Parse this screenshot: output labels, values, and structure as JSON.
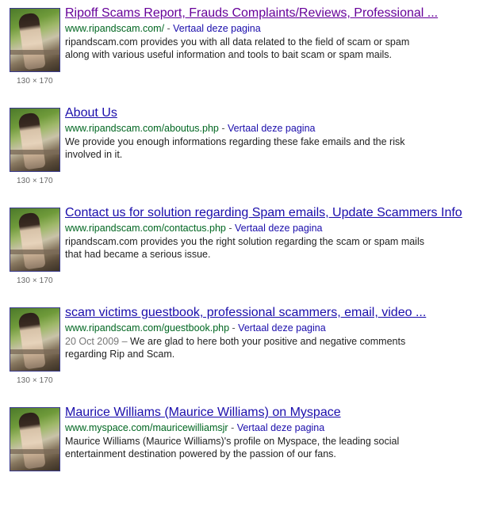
{
  "results": [
    {
      "title": "Ripoff Scams Report, Frauds Complaints/Reviews, Professional ...",
      "url": "www.ripandscam.com/",
      "translate": "Vertaal deze pagina",
      "date": "",
      "snippet_lines": [
        "ripandscam.com provides you with all data related to the field of scam or spam",
        "along with various useful information and tools to bait scam or spam mails."
      ],
      "image_size": "130 × 170"
    },
    {
      "title": "About Us",
      "url": "www.ripandscam.com/aboutus.php",
      "translate": "Vertaal deze pagina",
      "date": "",
      "snippet_lines": [
        "We provide you enough informations regarding these fake emails and the risk",
        "involved in it."
      ],
      "image_size": "130 × 170"
    },
    {
      "title": "Contact us for solution regarding Spam emails, Update Scammers Info",
      "url": "www.ripandscam.com/contactus.php",
      "translate": "Vertaal deze pagina",
      "date": "",
      "snippet_lines": [
        "ripandscam.com provides you the right solution regarding the scam or spam mails",
        "that had became a serious issue."
      ],
      "image_size": "130 × 170"
    },
    {
      "title": "scam victims guestbook, professional scammers, email, video ...",
      "url": "www.ripandscam.com/guestbook.php",
      "translate": "Vertaal deze pagina",
      "date": "20 Oct 2009 – ",
      "snippet_lines": [
        "We are glad to here both your positive and negative comments",
        "regarding Rip and Scam."
      ],
      "image_size": "130 × 170"
    },
    {
      "title": "Maurice Williams (Maurice Williams) on Myspace",
      "url": "www.myspace.com/mauricewilliamsjr",
      "translate": "Vertaal deze pagina",
      "date": "",
      "snippet_lines": [
        "Maurice Williams (Maurice Williams)'s profile on Myspace, the leading social",
        "entertainment destination powered by the passion of our fans."
      ],
      "image_size": ""
    }
  ],
  "separator": " - ",
  "colors": {
    "title_link": "#1a0dab",
    "visited_link": "#660099",
    "url_green": "#006621",
    "snippet_text": "#222222"
  }
}
